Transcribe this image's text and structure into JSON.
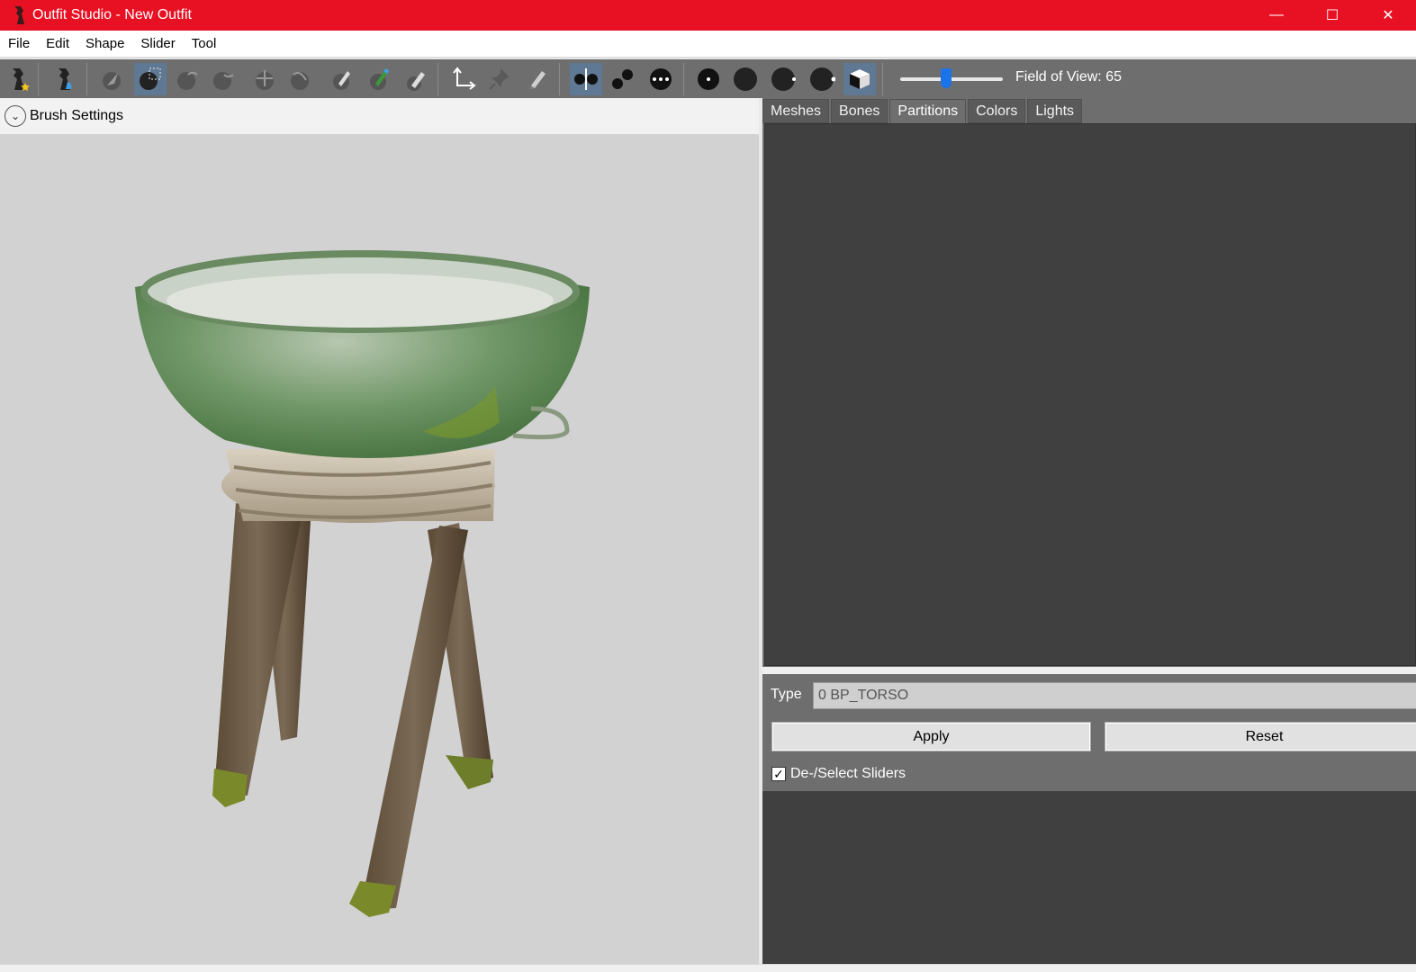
{
  "window": {
    "title": "Outfit Studio - New Outfit",
    "title_bar_color": "#e81123",
    "controls": [
      "minimize-icon",
      "maximize-icon",
      "close-icon"
    ]
  },
  "menu": [
    "File",
    "Edit",
    "Shape",
    "Slider",
    "Tool"
  ],
  "toolbar": {
    "buttons": [
      {
        "name": "new-project-icon"
      },
      {
        "name": "load-outfit-icon"
      },
      {
        "name": "select-brush-icon"
      },
      {
        "name": "mask-brush-icon",
        "active": true
      },
      {
        "name": "inflate-brush-icon"
      },
      {
        "name": "deflate-brush-icon"
      },
      {
        "name": "move-brush-icon"
      },
      {
        "name": "smooth-brush-icon"
      },
      {
        "name": "undiff-brush-icon"
      },
      {
        "name": "weight-brush-icon"
      },
      {
        "name": "color-brush-icon"
      },
      {
        "name": "transform-icon"
      },
      {
        "name": "pivot-icon"
      },
      {
        "name": "vertex-edit-icon"
      },
      {
        "name": "x-mirror-icon",
        "active": true
      },
      {
        "name": "connected-only-icon"
      },
      {
        "name": "global-brush-icon"
      },
      {
        "name": "wireframe-icon"
      },
      {
        "name": "lighting-icon"
      },
      {
        "name": "textures-icon"
      },
      {
        "name": "vertex-colors-icon"
      },
      {
        "name": "shading-cube-icon",
        "active": true
      }
    ],
    "field_of_view_label": "Field of View: 65",
    "field_of_view_value": 65
  },
  "brush_settings": {
    "label": "Brush Settings"
  },
  "tabs": [
    {
      "label": "Meshes",
      "active": false
    },
    {
      "label": "Bones",
      "active": false
    },
    {
      "label": "Partitions",
      "active": true
    },
    {
      "label": "Colors",
      "active": false
    },
    {
      "label": "Lights",
      "active": false
    }
  ],
  "partitions": {
    "type_label": "Type",
    "type_value": "0 BP_TORSO",
    "apply_label": "Apply",
    "reset_label": "Reset",
    "deselect_sliders_label": "De-/Select Sliders",
    "deselect_sliders_checked": true
  }
}
